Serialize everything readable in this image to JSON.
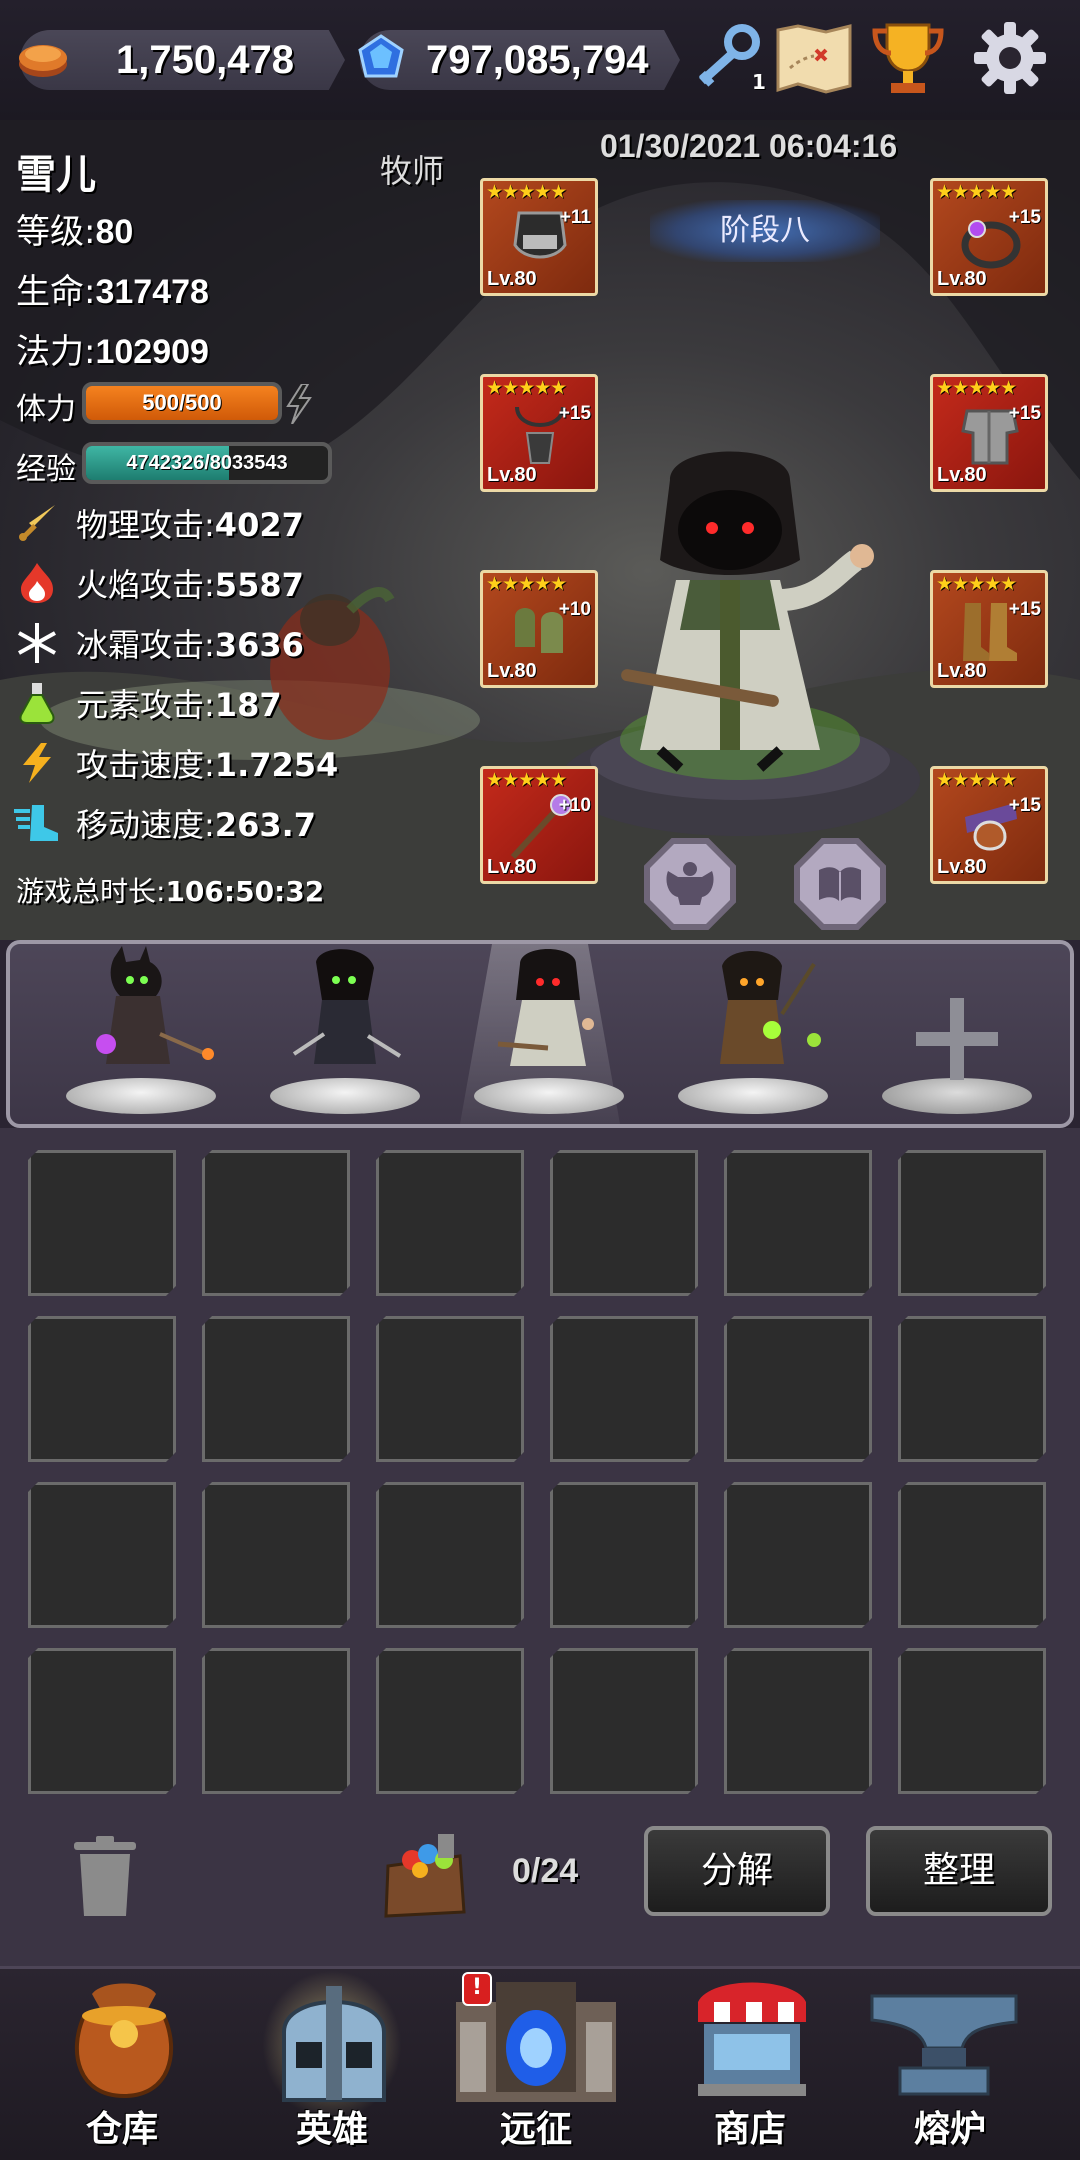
{
  "resources": {
    "gold": "1,750,478",
    "gems": "797,085,794",
    "key_count": "1"
  },
  "top_icons": [
    "key-icon",
    "treasure-map-icon",
    "trophy-icon",
    "gear-icon"
  ],
  "hero": {
    "name": "雪儿",
    "class": "牧师",
    "level_label": "等级:",
    "level": "80",
    "hp_label": "生命:",
    "hp": "317478",
    "mp_label": "法力:",
    "mp": "102909",
    "stamina_label": "体力",
    "stamina": "500/500",
    "stamina_fraction": 1.0,
    "exp_label": "经验",
    "exp": "4742326/8033543",
    "exp_fraction": 0.59,
    "attributes": [
      {
        "label": "物理攻击:",
        "value": "4027",
        "icon": "sword-icon"
      },
      {
        "label": "火焰攻击:",
        "value": "5587",
        "icon": "fire-icon"
      },
      {
        "label": "冰霜攻击:",
        "value": "3636",
        "icon": "snowflake-icon"
      },
      {
        "label": "元素攻击:",
        "value": "187",
        "icon": "potion-icon"
      },
      {
        "label": "攻击速度:",
        "value": "1.7254",
        "icon": "lightning-icon"
      },
      {
        "label": "移动速度:",
        "value": "263.7",
        "icon": "winged-boot-icon"
      }
    ],
    "playtime_label": "游戏总时长:",
    "playtime": "106:50:32"
  },
  "datetime": "01/30/2021 06:04:16",
  "stage": "阶段八",
  "equipment": [
    {
      "slot": "head",
      "stars": "★★★★★",
      "plus": "+11",
      "level": "Lv.80"
    },
    {
      "slot": "amulet",
      "stars": "★★★★★",
      "plus": "+15",
      "level": "Lv.80"
    },
    {
      "slot": "gloves",
      "stars": "★★★★★",
      "plus": "+10",
      "level": "Lv.80"
    },
    {
      "slot": "weapon",
      "stars": "★★★★★",
      "plus": "+10",
      "level": "Lv.80"
    },
    {
      "slot": "ring",
      "stars": "★★★★★",
      "plus": "+15",
      "level": "Lv.80"
    },
    {
      "slot": "armor",
      "stars": "★★★★★",
      "plus": "+15",
      "level": "Lv.80"
    },
    {
      "slot": "boots",
      "stars": "★★★★★",
      "plus": "+15",
      "level": "Lv.80"
    },
    {
      "slot": "belt",
      "stars": "★★★★★",
      "plus": "+15",
      "level": "Lv.80"
    }
  ],
  "inventory": {
    "count": "0/24",
    "decompose_label": "分解",
    "sort_label": "整理"
  },
  "nav": [
    {
      "label": "仓库",
      "icon": "bag-icon"
    },
    {
      "label": "英雄",
      "icon": "helmet-icon"
    },
    {
      "label": "远征",
      "icon": "portal-icon",
      "badge": "!"
    },
    {
      "label": "商店",
      "icon": "shop-icon"
    },
    {
      "label": "熔炉",
      "icon": "anvil-icon"
    }
  ]
}
